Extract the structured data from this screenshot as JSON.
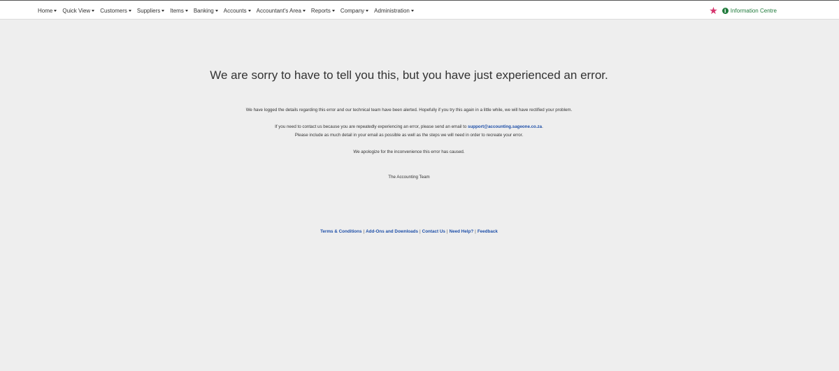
{
  "nav": {
    "items": [
      {
        "label": "Home"
      },
      {
        "label": "Quick View"
      },
      {
        "label": "Customers"
      },
      {
        "label": "Suppliers"
      },
      {
        "label": "Items"
      },
      {
        "label": "Banking"
      },
      {
        "label": "Accounts"
      },
      {
        "label": "Accountant's Area"
      },
      {
        "label": "Reports"
      },
      {
        "label": "Company"
      },
      {
        "label": "Administration"
      }
    ],
    "info_label": "Information Centre",
    "info_icon_glyph": "i"
  },
  "error": {
    "headline": "We are sorry to have to tell you this, but you have just experienced an error.",
    "line1": "We have logged the details regarding this error and our technical team have been alerted. Hopefully if you try this again in a little while, we will have rectified your problem.",
    "line2_prefix": "If you need to contact us because you are repeatedly experiencing an error, please send an email to ",
    "support_email": "support@accounting.sageone.co.za",
    "line2_suffix": ".",
    "line3": "Please include as much detail in your email as possible as well as the steps we will need in order to recreate your error.",
    "apology": "We apologize for the inconvenience this error has caused.",
    "signature": "The Accounting Team"
  },
  "footer": {
    "terms": "Terms & Conditions",
    "addons": "Add-Ons and Downloads",
    "contact": "Contact Us",
    "help": "Need Help?",
    "feedback": "Feedback",
    "separator": "|"
  },
  "colors": {
    "accent_green": "#1f7a3b",
    "star_pink": "#d6336c",
    "link_blue": "#1e4fa8",
    "page_bg": "#eeeeee"
  }
}
